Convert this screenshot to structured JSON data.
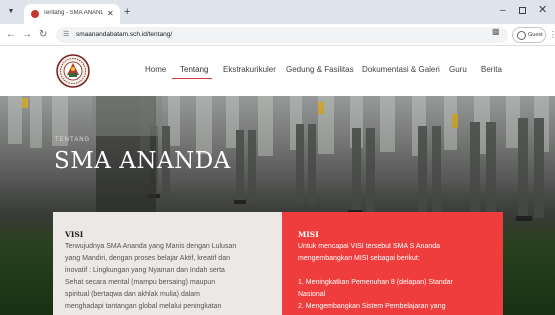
{
  "browser": {
    "tab_title": "Tentang - SMA ANANDA BATA",
    "new_tab_symbol": "+",
    "url": "smaanandabatam.sch.id/tentang/",
    "profile_label": "Guest"
  },
  "site": {
    "nav": [
      "Home",
      "Tentang",
      "Ekstrakurikuler",
      "Gedung & Fasilitas",
      "Dokumentasi & Galeri",
      "Guru",
      "Berita"
    ],
    "active_nav": "Tentang"
  },
  "hero": {
    "kicker": "TENTANG",
    "title": "SMA ANANDA"
  },
  "visi": {
    "heading": "VISI",
    "lines": [
      "Terwujudnya SMA Ananda yang Manis dengan Lulusan",
      "yang Mandiri, dengan proses belajar Aktif, kreatif dan",
      "inovatif : Lingkungan yang Nyaman dan Indah serta",
      "Sehat secara mental (mampu bersaing) maupun",
      "spiritual (bertaqwa dan akhlak mulia) dalam",
      "menghadapi tantangan global melalui peningkatan"
    ]
  },
  "misi": {
    "heading": "MISI",
    "intro_lines": [
      "Untuk mencapai VISI tersebut SMA S Ananda",
      "mengembangkan MISI sebagai berikut:"
    ],
    "items": [
      "1. Meningkatkan Pemenuhan 8 (delapan) Standar",
      "Nasional",
      "2. Mengembangkan Sistem Pembelajaran yang"
    ]
  },
  "colors": {
    "accent_red": "#ef3d3d",
    "visi_bg": "#ece8e5",
    "nav_underline": "#d63838"
  }
}
